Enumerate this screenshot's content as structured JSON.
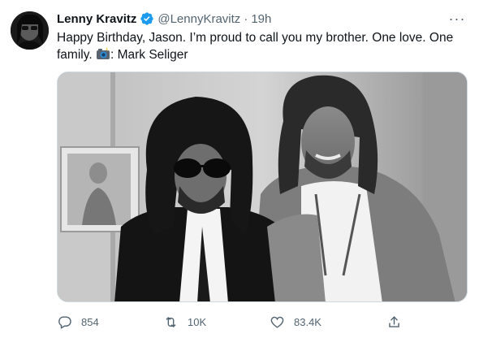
{
  "tweet": {
    "author_name": "Lenny Kravitz",
    "handle": "@LennyKravitz",
    "separator": "·",
    "time": "19h",
    "more_label": "···",
    "text_main": "Happy Birthday, Jason. I’m proud to call you my brother.  One love.  One family. ",
    "text_credit": ": Mark Seliger",
    "photo_icon": "camera-with-flash-icon",
    "verified_icon": "verified-badge-icon",
    "accent_color": "#1d9bf0"
  },
  "actions": {
    "reply_count": "854",
    "retweet_count": "10K",
    "like_count": "83.4K"
  }
}
